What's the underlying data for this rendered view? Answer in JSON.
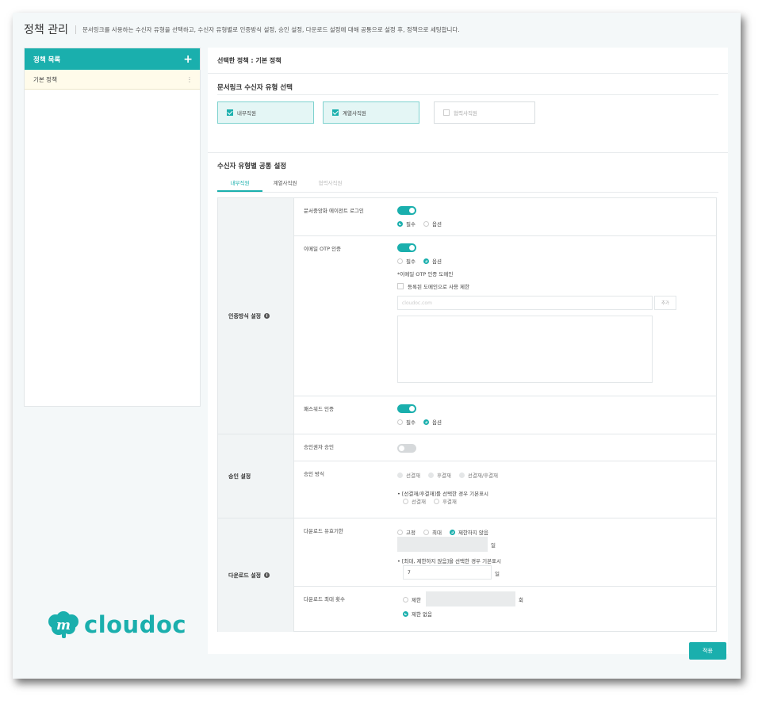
{
  "header": {
    "title": "정책 관리",
    "description": "문서링크를 사용하는 수신자 유형을 선택하고, 수신자 유형별로 인증방식 설정, 승인 설정, 다운로드 설정에 대해 공통으로 설정 후, 정책으로 세팅합니다."
  },
  "policy_list": {
    "title": "정책 목록",
    "add_icon": "+",
    "items": [
      {
        "label": "기본 정책"
      }
    ]
  },
  "brand": {
    "logo_text": "cloudoc",
    "color": "#1aafad"
  },
  "selected": {
    "label": "선택한 정책 : 기본 정책"
  },
  "recipient_types": {
    "title": "문서링크 수신자 유형 선택",
    "options": [
      {
        "label": "내부직원",
        "checked": true
      },
      {
        "label": "계열사직원",
        "checked": true
      },
      {
        "label": "협력사직원",
        "checked": false
      }
    ]
  },
  "common": {
    "title": "수신자 유형별 공통 설정",
    "tabs": [
      "내부직원",
      "계열사직원",
      "협력사직원"
    ]
  },
  "auth": {
    "category": "인증방식 설정",
    "agent_login": {
      "label": "문서중앙화 에이전트 로그인",
      "opt_required": "필수",
      "opt_optional": "옵션"
    },
    "email_otp": {
      "label": "이메일 OTP 인증",
      "opt_required": "필수",
      "opt_optional": "옵션",
      "domain_note": "*이메일 OTP 인증 도메인",
      "restrict_label": "등록된 도메인으로 사용 제한",
      "domain_placeholder": "cloudoc.com",
      "add_label": "추가"
    },
    "password": {
      "label": "패스워드 인증",
      "opt_required": "필수",
      "opt_optional": "옵션"
    }
  },
  "approval": {
    "category": "승인 설정",
    "approver": {
      "label": "승인권자 승인"
    },
    "method": {
      "label": "승인 방식",
      "opt_pre": "선결재",
      "opt_post": "후결재",
      "opt_both": "선결재/후결재",
      "default_note": "• [선결재/후결재]를 선택한 경우 기본표시",
      "default_pre": "선결재",
      "default_post": "후결재"
    }
  },
  "download": {
    "category": "다운로드 설정",
    "period": {
      "label": "다운로드 유효기한",
      "opt_fixed": "고정",
      "opt_max": "최대",
      "opt_unlimited": "제한하지 않음",
      "unit": "일",
      "default_note": "• [최대, 제한하지 않음]을 선택한 경우 기본표시",
      "default_value": "7",
      "default_unit": "일"
    },
    "max_count": {
      "label": "다운로드 최대 횟수",
      "opt_limit": "제한",
      "unit": "회",
      "opt_none": "제한 없음"
    }
  },
  "actions": {
    "apply": "적용"
  }
}
